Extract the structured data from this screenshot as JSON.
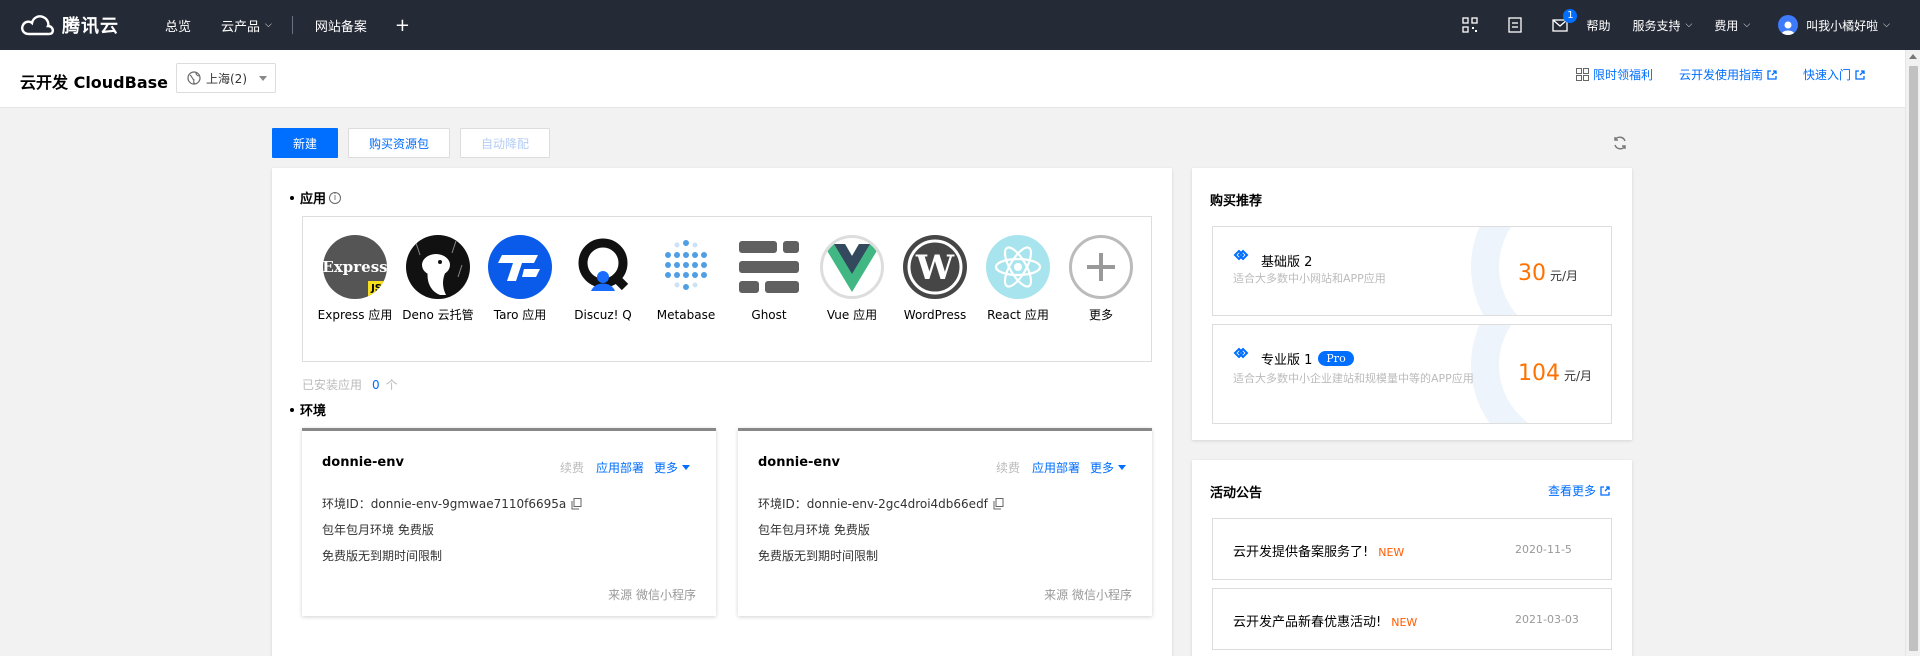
{
  "topnav": {
    "brand": "腾讯云",
    "items": [
      {
        "label": "总览"
      },
      {
        "label": "云产品",
        "caret": true
      },
      {
        "label": "网站备案"
      }
    ],
    "plus": "+",
    "mail_badge": "1",
    "help": "帮助",
    "service": "服务支持",
    "billing": "费用",
    "user": "叫我小橘好啦"
  },
  "subheader": {
    "title": "云开发 CloudBase",
    "region": "上海(2)",
    "links": [
      "限时领福利",
      "云开发使用指南",
      "快速入门"
    ]
  },
  "toolbar": {
    "new": "新建",
    "buy": "购买资源包",
    "auto": "自动降配"
  },
  "apps": {
    "title": "应用",
    "info": "i",
    "items": [
      {
        "name": "Express 应用",
        "icon": "express-icon"
      },
      {
        "name": "Deno 云托管",
        "icon": "deno-icon"
      },
      {
        "name": "Taro 应用",
        "icon": "taro-icon"
      },
      {
        "name": "Discuz! Q",
        "icon": "discuz-icon"
      },
      {
        "name": "Metabase",
        "icon": "metabase-icon"
      },
      {
        "name": "Ghost",
        "icon": "ghost-icon"
      },
      {
        "name": "Vue 应用",
        "icon": "vue-icon"
      },
      {
        "name": "WordPress",
        "icon": "wordpress-icon"
      },
      {
        "name": "React 应用",
        "icon": "react-icon"
      },
      {
        "name": "更多",
        "icon": "plus-icon"
      }
    ],
    "express_logo": "Express",
    "express_js": "JS",
    "installed_label": "已安装应用",
    "installed_count": "0",
    "installed_unit": "个"
  },
  "envs": {
    "title": "环境",
    "items": [
      {
        "name": "donnie-env",
        "renew": "续费",
        "deploy": "应用部署",
        "more": "更多",
        "id": "环境ID：donnie-env-9gmwae7110f6695a",
        "plan": "包年包月环境  免费版",
        "limit": "免费版无到期时间限制",
        "source": "来源 微信小程序"
      },
      {
        "name": "donnie-env",
        "renew": "续费",
        "deploy": "应用部署",
        "more": "更多",
        "id": "环境ID：donnie-env-2gc4droi4db66edf",
        "plan": "包年包月环境  免费版",
        "limit": "免费版无到期时间限制",
        "source": "来源 微信小程序"
      }
    ]
  },
  "purchase": {
    "title": "购买推荐",
    "plans": [
      {
        "name": "基础版 2",
        "desc": "适合大多数中小网站和APP应用",
        "price": "30",
        "unit": "元/月"
      },
      {
        "name": "专业版 1",
        "tag": "Pro",
        "desc": "适合大多数中小企业建站和规模量中等的APP应用",
        "price": "104",
        "unit": "元/月"
      }
    ]
  },
  "notices": {
    "title": "活动公告",
    "more": "查看更多",
    "items": [
      {
        "title": "云开发提供备案服务了!",
        "badge": "NEW",
        "date": "2020-11-5"
      },
      {
        "title": "云开发产品新春优惠活动!",
        "badge": "NEW",
        "date": "2021-03-03"
      }
    ]
  },
  "colors": {
    "nav_bg": "#242a36",
    "primary": "#006eff",
    "price": "#ff7200"
  }
}
